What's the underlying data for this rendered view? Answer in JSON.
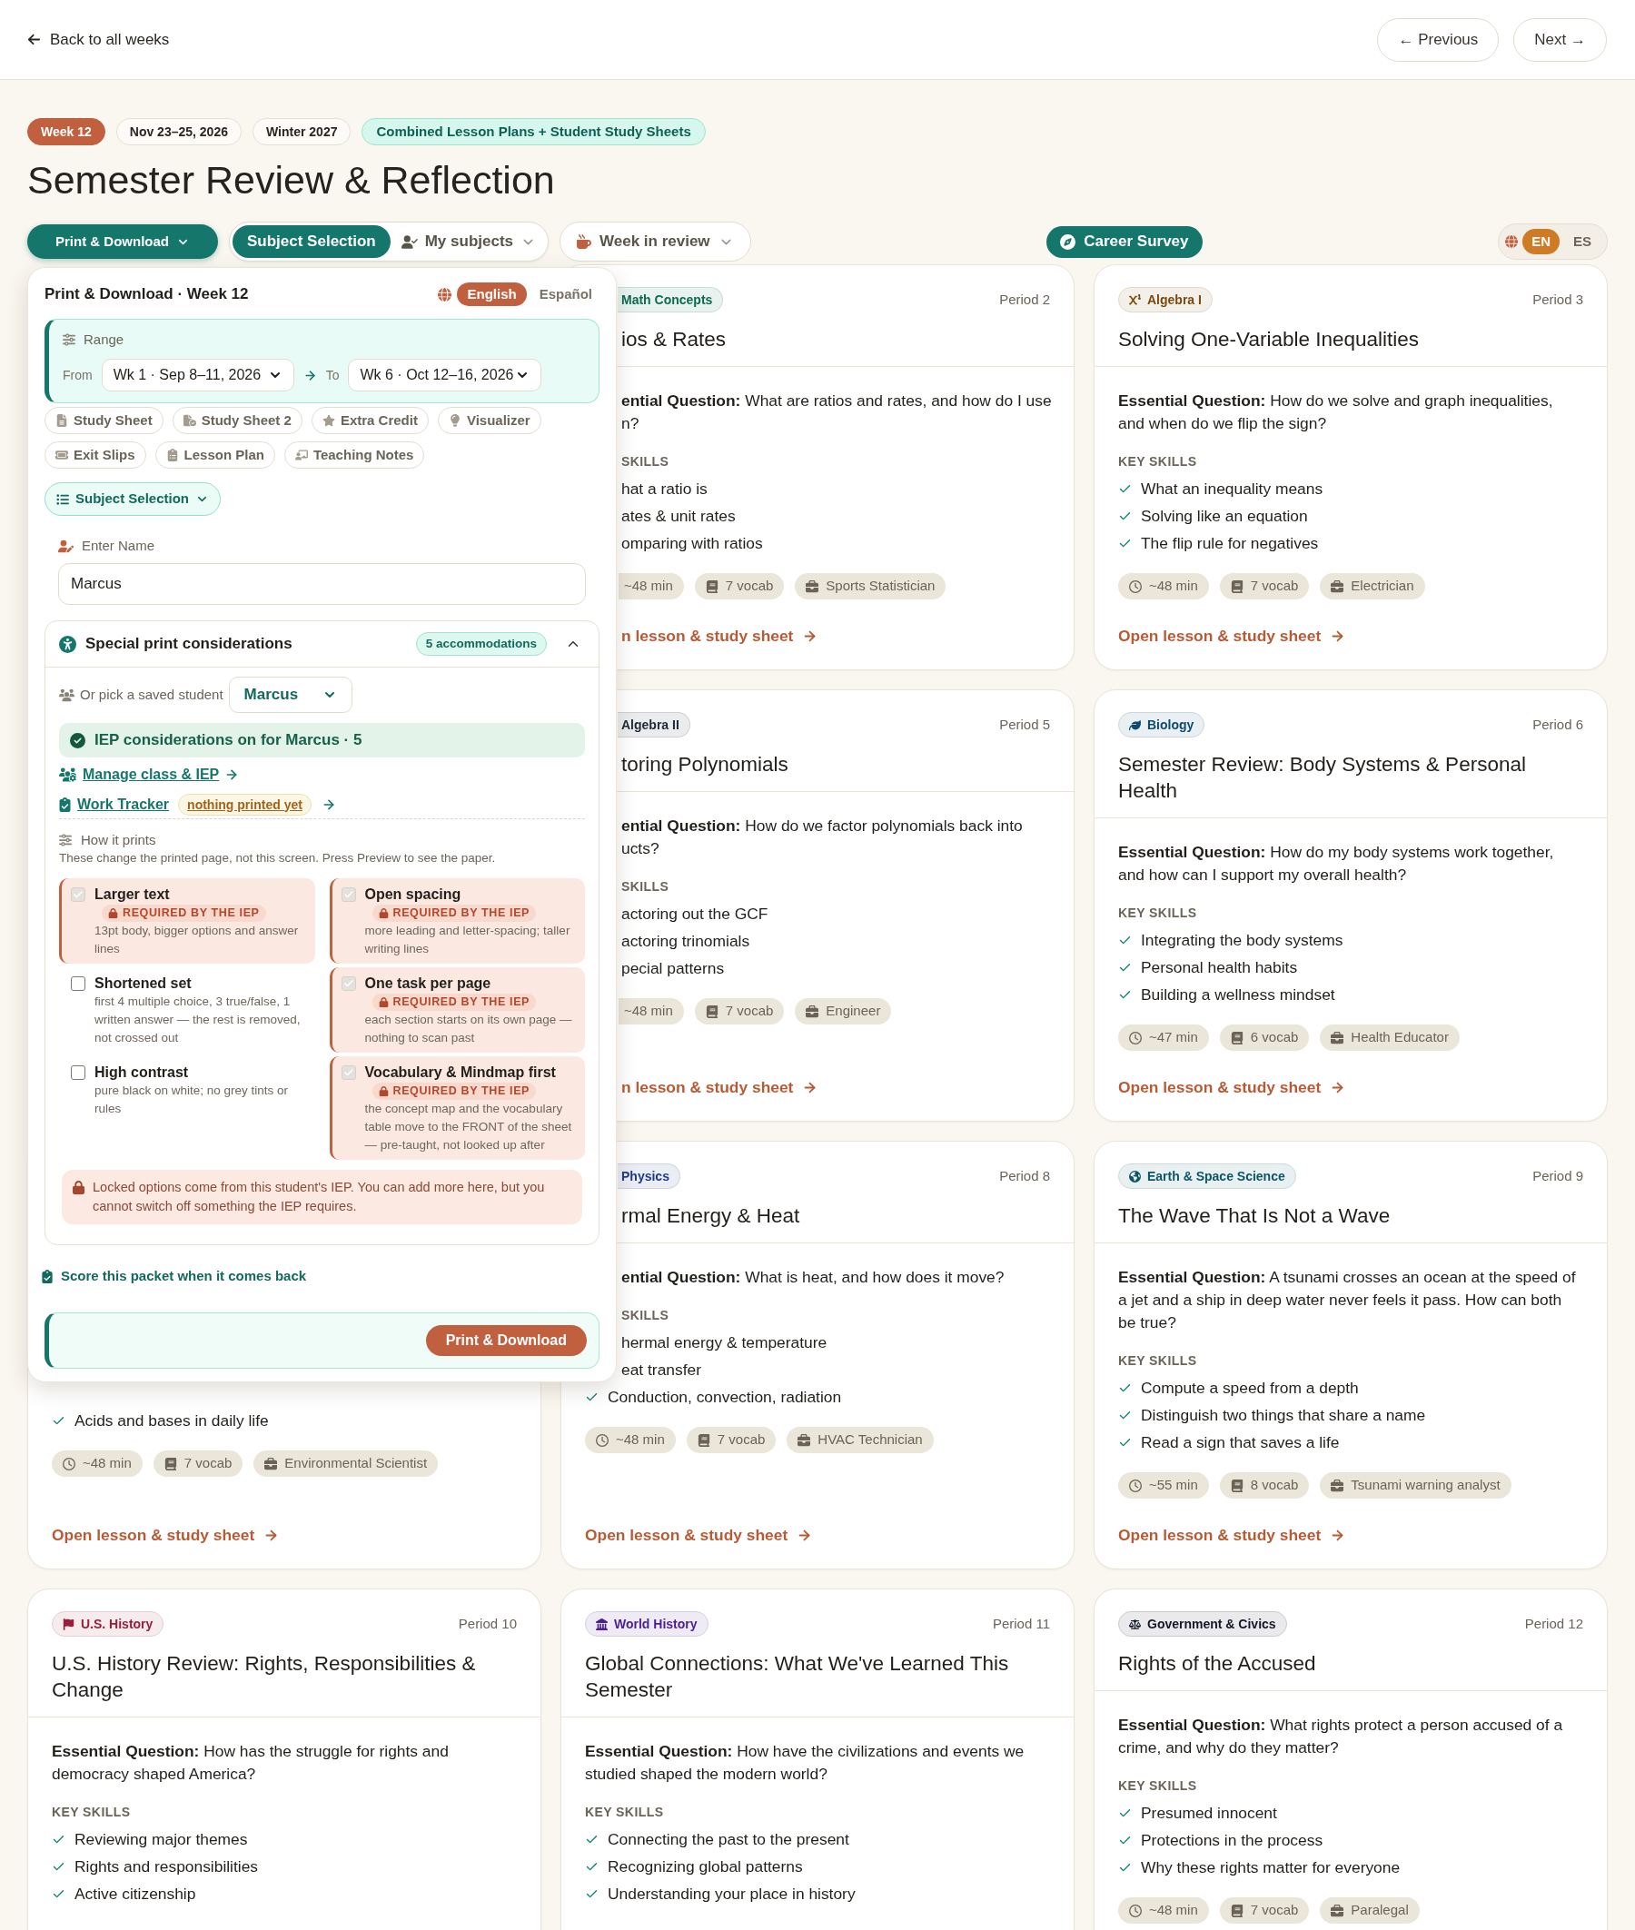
{
  "nav": {
    "back": "Back to all weeks",
    "previous": "← Previous",
    "next": "Next →"
  },
  "tags": [
    {
      "label": "Week 12",
      "kind": "week"
    },
    {
      "label": "Nov 23–25, 2026",
      "kind": "plain"
    },
    {
      "label": "Winter 2027",
      "kind": "plain"
    },
    {
      "label": "Combined Lesson Plans + Student Study Sheets",
      "kind": "mint"
    }
  ],
  "title": "Semester Review & Reflection",
  "toolbar": {
    "print": {
      "label": "Print & Download",
      "expanded": true
    },
    "views": [
      {
        "label": "Subject Selection",
        "selected": true
      },
      {
        "label": "My subjects",
        "selected": false
      }
    ],
    "week_review": "Week in review",
    "career_survey": "Career Survey",
    "language_switch": [
      {
        "label": "EN",
        "selected": true
      },
      {
        "label": "ES",
        "selected": false
      }
    ]
  },
  "print_panel": {
    "title": "Print & Download · Week 12",
    "languages": [
      {
        "label": "English",
        "selected": true
      },
      {
        "label": "Español",
        "selected": false
      }
    ],
    "range": {
      "label": "Range",
      "from_label": "From",
      "from": "Wk 1 · Sep 8–11, 2026",
      "to_label": "To",
      "to": "Wk 6 · Oct 12–16, 2026"
    },
    "materials": [
      "Study Sheet",
      "Study Sheet 2",
      "Extra Credit",
      "Visualizer",
      "Exit Slips",
      "Lesson Plan",
      "Teaching Notes"
    ],
    "subject_button": "Subject Selection",
    "name_field": {
      "label": "Enter Name",
      "value": "Marcus"
    },
    "accommodations": {
      "title": "Special print considerations",
      "count": "5 accommodations",
      "expanded": true,
      "saved_student_label": "Or pick a saved student",
      "saved_student": "Marcus",
      "status": "IEP considerations on for Marcus · 5",
      "manage_link": "Manage class & IEP",
      "tracker_link": "Work Tracker",
      "tracker_badge": "nothing printed yet",
      "how_label": "How it prints",
      "how_note": "These change the printed page, not this screen. Press Preview to see the paper.",
      "options": [
        {
          "label": "Larger text",
          "checked": true,
          "locked": true,
          "badge": "REQUIRED BY THE IEP",
          "description": "13pt body, bigger options and answer lines"
        },
        {
          "label": "Open spacing",
          "checked": true,
          "locked": true,
          "badge": "REQUIRED BY THE IEP",
          "description": "more leading and letter-spacing; taller writing lines"
        },
        {
          "label": "Shortened set",
          "checked": false,
          "locked": false,
          "description": "first 4 multiple choice, 3 true/false, 1 written answer — the rest is removed, not crossed out"
        },
        {
          "label": "One task per page",
          "checked": true,
          "locked": true,
          "badge": "REQUIRED BY THE IEP",
          "description": "each section starts on its own page — nothing to scan past"
        },
        {
          "label": "High contrast",
          "checked": false,
          "locked": false,
          "description": "pure black on white; no grey tints or rules"
        },
        {
          "label": "Vocabulary & Mindmap first",
          "checked": true,
          "locked": true,
          "badge": "REQUIRED BY THE IEP",
          "description": "the concept map and the vocabulary table move to the FRONT of the sheet — pre-taught, not looked up after"
        }
      ],
      "locked_note": "Locked options come from this student's IEP. You can add more here, but you cannot switch off something the IEP requires."
    },
    "score_link": "Score this packet when it comes back",
    "submit": "Print & Download"
  },
  "cards": [
    {
      "subject": {
        "label": "Math Concepts",
        "color": "#0b6b4f"
      },
      "period": "Period 2",
      "title": "ios & Rates",
      "question": "**ential Question:** What are ratios and rates, and how do I use\nn?",
      "skills_heading": "SKILLS",
      "skills": [
        "hat a ratio is",
        "ates & unit rates",
        "omparing with ratios"
      ],
      "meta": {
        "duration": "~48 min",
        "vocab": "7 vocab",
        "career": "Sports Statistician"
      },
      "link": "n lesson & study sheet"
    },
    {
      "subject": {
        "label": "Algebra I",
        "color": "#7a4a0c"
      },
      "period": "Period 3",
      "title": "Solving One-Variable Inequalities",
      "question": "**Essential Question:** How do we solve and graph inequalities, and when do we flip the sign?",
      "skills_heading": "KEY SKILLS",
      "skills": [
        "What an inequality means",
        "Solving like an equation",
        "The flip rule for negatives"
      ],
      "meta": {
        "duration": "~48 min",
        "vocab": "7 vocab",
        "career": "Electrician"
      },
      "link": "Open lesson & study sheet"
    },
    {
      "subject": {
        "label": "Algebra II",
        "color": "#1f2937"
      },
      "period": "Period 5",
      "title": "toring Polynomials",
      "question": "**ential Question:** How do we factor polynomials back into\nucts?",
      "skills_heading": "SKILLS",
      "skills": [
        "actoring out the GCF",
        "actoring trinomials",
        "pecial patterns"
      ],
      "meta": {
        "duration": "~48 min",
        "vocab": "7 vocab",
        "career": "Engineer"
      },
      "link": "n lesson & study sheet"
    },
    {
      "subject": {
        "label": "Biology",
        "color": "#0c4a6e"
      },
      "period": "Period 6",
      "title": "Semester Review: Body Systems & Personal Health",
      "question": "**Essential Question:** How do my body systems work together, and how can I support my overall health?",
      "skills_heading": "KEY SKILLS",
      "skills": [
        "Integrating the body systems",
        "Personal health habits",
        "Building a wellness mindset"
      ],
      "meta": {
        "duration": "~47 min",
        "vocab": "6 vocab",
        "career": "Health Educator"
      },
      "link": "Open lesson & study sheet"
    },
    {
      "skills": [
        "Acids and bases in daily life"
      ],
      "meta": {
        "duration": "~48 min",
        "vocab": "7 vocab",
        "career": "Environmental Scientist"
      },
      "link": "Open lesson & study sheet"
    },
    {
      "subject": {
        "label": "Physics",
        "color": "#1e3a8a"
      },
      "period": "Period 8",
      "title": "rmal Energy & Heat",
      "question": "**ential Question:** What is heat, and how does it move?",
      "skills_heading": "SKILLS",
      "skills": [
        "hermal energy & temperature",
        "eat transfer",
        "Conduction, convection, radiation"
      ],
      "meta": {
        "duration": "~48 min",
        "vocab": "7 vocab",
        "career": "HVAC Technician"
      },
      "link": "Open lesson & study sheet"
    },
    {
      "subject": {
        "label": "Earth & Space Science",
        "color": "#0e5568"
      },
      "period": "Period 9",
      "title": "The Wave That Is Not a Wave",
      "question": "**Essential Question:** A tsunami crosses an ocean at the speed of a jet and a ship in deep water never feels it pass. How can both be true?",
      "skills_heading": "KEY SKILLS",
      "skills": [
        "Compute a speed from a depth",
        "Distinguish two things that share a name",
        "Read a sign that saves a life"
      ],
      "meta": {
        "duration": "~55 min",
        "vocab": "8 vocab",
        "career": "Tsunami warning analyst"
      },
      "link": "Open lesson & study sheet"
    },
    {
      "subject": {
        "label": "U.S. History",
        "color": "#9b1c3b"
      },
      "period": "Period 10",
      "title": "U.S. History Review: Rights, Responsibilities & Change",
      "question": "**Essential Question:** How has the struggle for rights and democracy shaped America?",
      "skills_heading": "KEY SKILLS",
      "skills": [
        "Reviewing major themes",
        "Rights and responsibilities",
        "Active citizenship"
      ]
    },
    {
      "subject": {
        "label": "World History",
        "color": "#4c1d95"
      },
      "period": "Period 11",
      "title": "Global Connections: What We've Learned This Semester",
      "question": "**Essential Question:** How have the civilizations and events we studied shaped the modern world?",
      "skills_heading": "KEY SKILLS",
      "skills": [
        "Connecting the past to the present",
        "Recognizing global patterns",
        "Understanding your place in history"
      ]
    },
    {
      "subject": {
        "label": "Government & Civics",
        "color": "#111827"
      },
      "period": "Period 12",
      "title": "Rights of the Accused",
      "question": "**Essential Question:** What rights protect a person accused of a crime, and why do they matter?",
      "skills_heading": "KEY SKILLS",
      "skills": [
        "Presumed innocent",
        "Protections in the process",
        "Why these rights matter for everyone"
      ],
      "meta": {
        "duration": "~48 min",
        "vocab": "7 vocab",
        "career": "Paralegal"
      }
    }
  ]
}
